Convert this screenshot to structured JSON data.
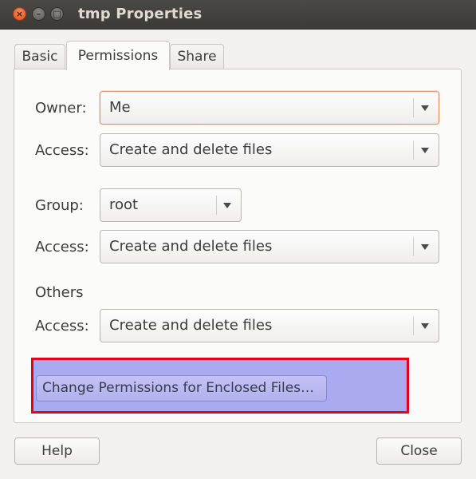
{
  "window": {
    "title": "tmp Properties",
    "controls": {
      "close": "×",
      "minimize": "–",
      "maximize": "□"
    }
  },
  "tabs": [
    {
      "label": "Basic",
      "active": false
    },
    {
      "label": "Permissions",
      "active": true
    },
    {
      "label": "Share",
      "active": false
    }
  ],
  "owner": {
    "label": "Owner:",
    "value": "Me",
    "access_label": "Access:",
    "access_value": "Create and delete files"
  },
  "group": {
    "label": "Group:",
    "value": "root",
    "access_label": "Access:",
    "access_value": "Create and delete files"
  },
  "others": {
    "label": "Others",
    "access_label": "Access:",
    "access_value": "Create and delete files"
  },
  "enclosed_button": "Change Permissions for Enclosed Files…",
  "footer": {
    "help": "Help",
    "close": "Close"
  },
  "colors": {
    "highlight_border": "#e3001b",
    "highlight_fill": "#aaaaf0",
    "focus_border": "#e09066",
    "titlebar": "#3b3a36"
  }
}
